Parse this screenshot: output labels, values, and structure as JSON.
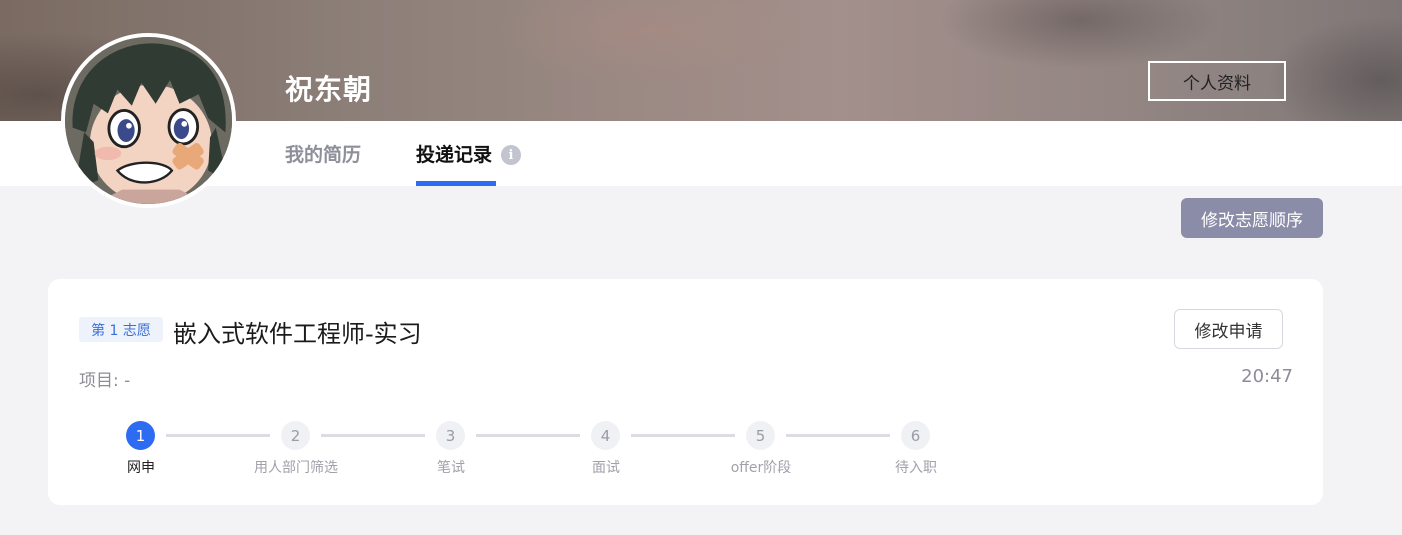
{
  "header": {
    "user_name": "祝东朝",
    "profile_button": "个人资料"
  },
  "tabs": [
    {
      "label": "我的简历",
      "active": false
    },
    {
      "label": "投递记录",
      "active": true
    }
  ],
  "info_icon_glyph": "i",
  "reorder_button": "修改志愿顺序",
  "application": {
    "preference_badge": "第 1 志愿",
    "job_title": "嵌入式软件工程师-实习",
    "edit_button": "修改申请",
    "project": "项目:  -",
    "time": "20:47",
    "current_step": 1,
    "steps": [
      {
        "num": "1",
        "label": "网申"
      },
      {
        "num": "2",
        "label": "用人部门筛选"
      },
      {
        "num": "3",
        "label": "笔试"
      },
      {
        "num": "4",
        "label": "面试"
      },
      {
        "num": "5",
        "label": "offer阶段"
      },
      {
        "num": "6",
        "label": "待入职"
      }
    ]
  },
  "colors": {
    "accent": "#2d6cf2",
    "reorder_button_bg": "#8a8ca8",
    "page_bg": "#f3f3f5"
  },
  "icons": [
    "avatar-anime-portrait",
    "info-icon"
  ]
}
